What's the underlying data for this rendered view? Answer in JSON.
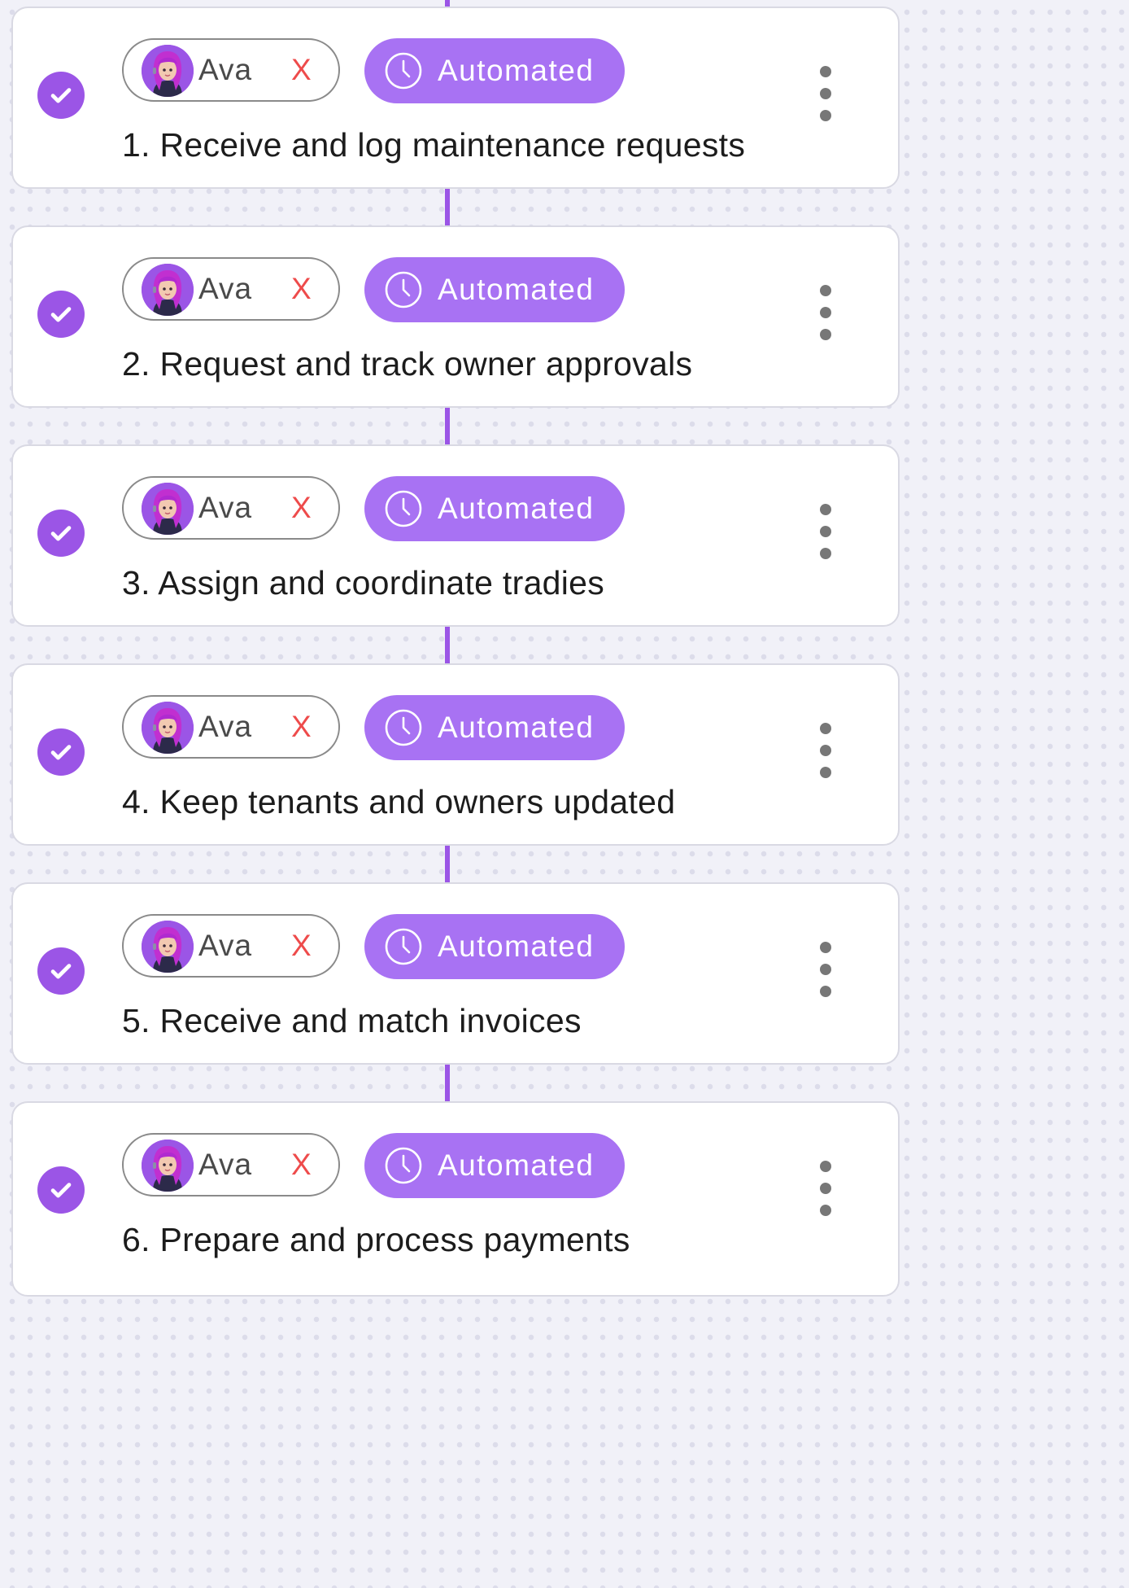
{
  "accent_color": "#9b55e6",
  "badge_color": "#a872f3",
  "remove_color": "#ee4b4b",
  "steps": [
    {
      "assignee": "Ava",
      "remove": "X",
      "badge": "Automated",
      "title": "1. Receive and log maintenance requests",
      "status_icon": "check-circle-icon"
    },
    {
      "assignee": "Ava",
      "remove": "X",
      "badge": "Automated",
      "title": "2. Request and track owner approvals",
      "status_icon": "check-circle-icon"
    },
    {
      "assignee": "Ava",
      "remove": "X",
      "badge": "Automated",
      "title": "3. Assign and coordinate tradies",
      "status_icon": "check-circle-icon"
    },
    {
      "assignee": "Ava",
      "remove": "X",
      "badge": "Automated",
      "title": "4. Keep tenants and owners updated",
      "status_icon": "check-circle-icon"
    },
    {
      "assignee": "Ava",
      "remove": "X",
      "badge": "Automated",
      "title": "5. Receive and match invoices",
      "status_icon": "check-circle-icon"
    },
    {
      "assignee": "Ava",
      "remove": "X",
      "badge": "Automated",
      "title": "6. Prepare and process payments",
      "status_icon": "check-circle-icon"
    }
  ]
}
